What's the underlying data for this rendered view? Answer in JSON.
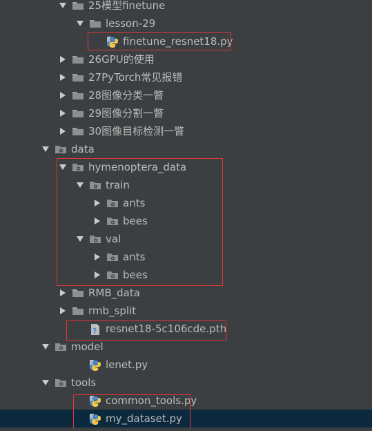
{
  "tree": {
    "items": [
      {
        "label": "25模型finetune",
        "level": 2,
        "type": "folder",
        "expanded": true
      },
      {
        "label": "lesson-29",
        "level": 3,
        "type": "folder",
        "expanded": true
      },
      {
        "label": "finetune_resnet18.py",
        "level": 4,
        "type": "python"
      },
      {
        "label": "26GPU的使用",
        "level": 2,
        "type": "folder",
        "expanded": false
      },
      {
        "label": "27PyTorch常见报错",
        "level": 2,
        "type": "folder",
        "expanded": false
      },
      {
        "label": "28图像分类一瞥",
        "level": 2,
        "type": "folder",
        "expanded": false
      },
      {
        "label": "29图像分割一瞥",
        "level": 2,
        "type": "folder",
        "expanded": false
      },
      {
        "label": "30图像目标检测一瞥",
        "level": 2,
        "type": "folder",
        "expanded": false
      },
      {
        "label": "data",
        "level": 1,
        "type": "module",
        "expanded": true
      },
      {
        "label": "hymenoptera_data",
        "level": 2,
        "type": "module",
        "expanded": true
      },
      {
        "label": "train",
        "level": 3,
        "type": "module",
        "expanded": true
      },
      {
        "label": "ants",
        "level": 4,
        "type": "module",
        "expanded": false
      },
      {
        "label": "bees",
        "level": 4,
        "type": "module",
        "expanded": false
      },
      {
        "label": "val",
        "level": 3,
        "type": "module",
        "expanded": true
      },
      {
        "label": "ants",
        "level": 4,
        "type": "module",
        "expanded": false
      },
      {
        "label": "bees",
        "level": 4,
        "type": "module",
        "expanded": false
      },
      {
        "label": "RMB_data",
        "level": 2,
        "type": "folder",
        "expanded": false
      },
      {
        "label": "rmb_split",
        "level": 2,
        "type": "folder",
        "expanded": false
      },
      {
        "label": "resnet18-5c106cde.pth",
        "level": 3,
        "type": "unknown"
      },
      {
        "label": "model",
        "level": 1,
        "type": "module",
        "expanded": true
      },
      {
        "label": "lenet.py",
        "level": 3,
        "type": "python"
      },
      {
        "label": "tools",
        "level": 1,
        "type": "module",
        "expanded": true
      },
      {
        "label": "common_tools.py",
        "level": 3,
        "type": "python"
      },
      {
        "label": "my_dataset.py",
        "level": 3,
        "type": "python",
        "selected": true
      }
    ]
  },
  "colors": {
    "background": "#3c3f41",
    "selection": "#0d293e",
    "text": "#bbbbbb",
    "folder_icon": "#8a8f94",
    "highlight_box": "#e0363b",
    "python_blue": "#4a86c5",
    "python_yellow": "#f0c94c"
  }
}
